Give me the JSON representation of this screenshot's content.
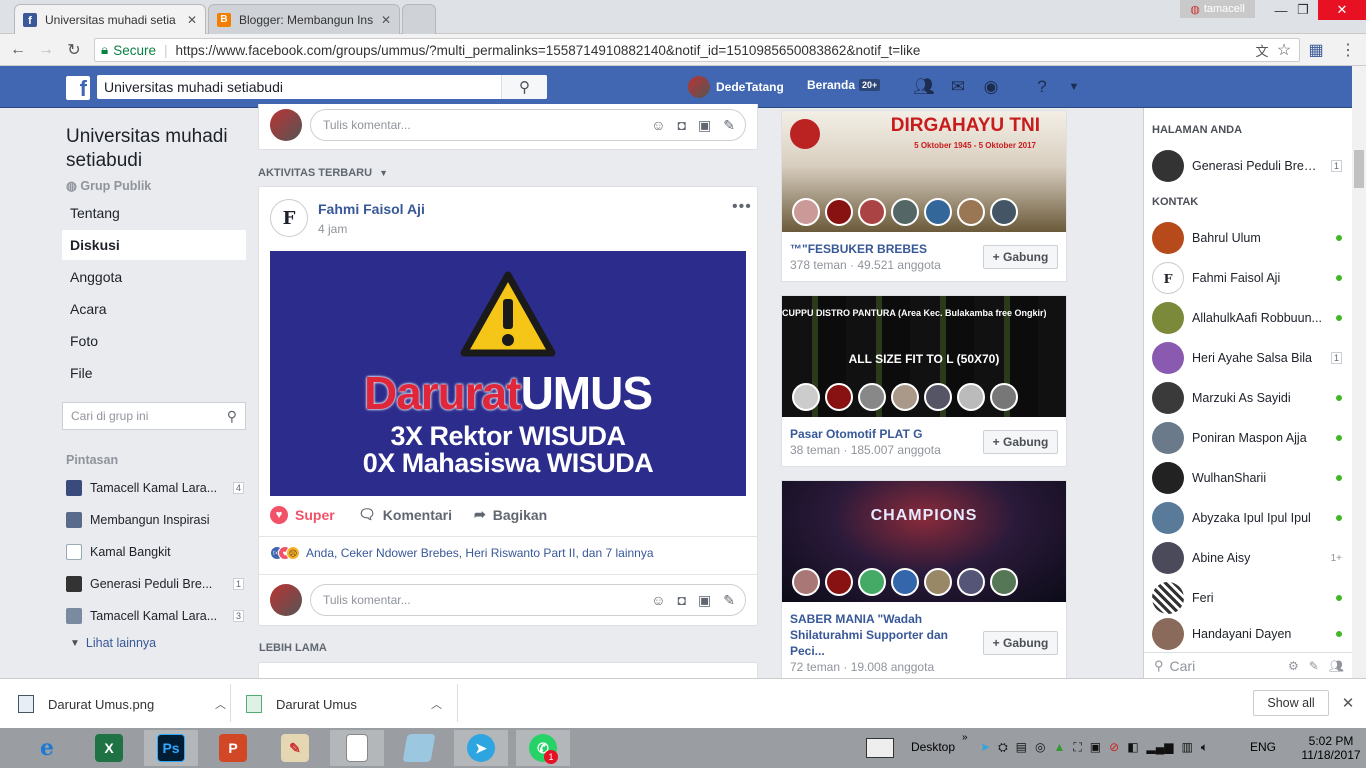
{
  "browser": {
    "tabs": [
      {
        "title": "Universitas muhadi setia",
        "icon": "facebook-favicon"
      },
      {
        "title": "Blogger: Membangun Ins",
        "icon": "blogger-favicon"
      }
    ],
    "profile_name": "tamacell",
    "secure_label": "Secure",
    "url": "https://www.facebook.com/groups/ummus/?multi_permalinks=1558714910882140&notif_id=1510985650083862&notif_t=like"
  },
  "fb_header": {
    "search_value": "Universitas muhadi setiabudi",
    "user_name": "DedeTatang",
    "home_label": "Beranda",
    "home_badge": "20+"
  },
  "left": {
    "group_title": "Universitas muhadi setiabudi",
    "group_type": "Grup Publik",
    "nav": [
      "Tentang",
      "Diskusi",
      "Anggota",
      "Acara",
      "Foto",
      "File"
    ],
    "selected_nav": "Diskusi",
    "search_placeholder": "Cari di grup ini",
    "shortcuts_title": "Pintasan",
    "shortcuts": [
      {
        "label": "Tamacell Kamal Lara...",
        "count": "4",
        "color": "#3a4a7a"
      },
      {
        "label": "Membangun Inspirasi",
        "count": "",
        "color": "#5a6a8a"
      },
      {
        "label": "Kamal Bangkit",
        "count": "",
        "color": "#9ab"
      },
      {
        "label": "Generasi Peduli Bre...",
        "count": "1",
        "color": "#333"
      },
      {
        "label": "Tamacell Kamal Lara...",
        "count": "3",
        "color": "#7a8aa0"
      }
    ],
    "see_more": "Lihat lainnya"
  },
  "feed": {
    "comment_placeholder": "Tulis komentar...",
    "recent_activity": "AKTIVITAS TERBARU",
    "post": {
      "author": "Fahmi Faisol Aji",
      "time": "4 jam",
      "image_text_red": "Darurat",
      "image_text_white": "UMUS",
      "image_line2": "3X Rektor WISUDA",
      "image_line3": "0X Mahasiswa WISUDA",
      "action_super": "Super",
      "action_comment": "Komentari",
      "action_share": "Bagikan",
      "reactions_text": "Anda, Ceker Ndower Brebes, Heri Riswanto Part II, dan 7 lainnya"
    },
    "older_label": "LEBIH LAMA"
  },
  "suggested_groups": [
    {
      "banner": "DIRGAHAYU TNI",
      "banner_sub": "5 Oktober 1945 - 5 Oktober 2017",
      "name": "™\"FESBUKER BREBES",
      "meta": "378 teman · 49.521 anggota",
      "join": "Gabung"
    },
    {
      "banner": "CUPPU DISTRO PANTURA (Area Kec. Bulakamba free Ongkir)",
      "banner_sub": "ALL SIZE FIT TO L (50X70)",
      "name": "Pasar Otomotif PLAT G",
      "meta": "38 teman · 185.007 anggota",
      "join": "Gabung"
    },
    {
      "banner": "CHAMPIONS",
      "banner_sub": "",
      "name": "SABER MANIA \"Wadah Shilaturahmi Supporter dan Peci...",
      "meta": "72 teman · 19.008 anggota",
      "join": "Gabung"
    }
  ],
  "chat": {
    "pages_title": "HALAMAN ANDA",
    "pages": [
      {
        "name": "Generasi Peduli Brebes",
        "count": "1"
      }
    ],
    "contacts_title": "KONTAK",
    "contacts": [
      {
        "name": "Bahrul Ulum",
        "status": "online"
      },
      {
        "name": "Fahmi Faisol Aji",
        "status": "online"
      },
      {
        "name": "AllahulkAafi Robbuun...",
        "status": "online"
      },
      {
        "name": "Heri Ayahe Salsa Bila",
        "status": "1"
      },
      {
        "name": "Marzuki As Sayidi",
        "status": "online"
      },
      {
        "name": "Poniran Maspon Ajja",
        "status": "online"
      },
      {
        "name": "WulhanSharii",
        "status": "online"
      },
      {
        "name": "Abyzaka Ipul Ipul Ipul",
        "status": "online"
      },
      {
        "name": "Abine Aisy",
        "status": "1+"
      },
      {
        "name": "Feri",
        "status": "online"
      },
      {
        "name": "Handayani Dayen",
        "status": "online"
      }
    ],
    "search_placeholder": "Cari"
  },
  "downloads": {
    "items": [
      "Darurat Umus.png",
      "Darurat Umus"
    ],
    "show_all": "Show all"
  },
  "taskbar": {
    "desktop_label": "Desktop",
    "lang": "ENG",
    "time": "5:02 PM",
    "date": "11/18/2017",
    "whatsapp_badge": "1"
  }
}
